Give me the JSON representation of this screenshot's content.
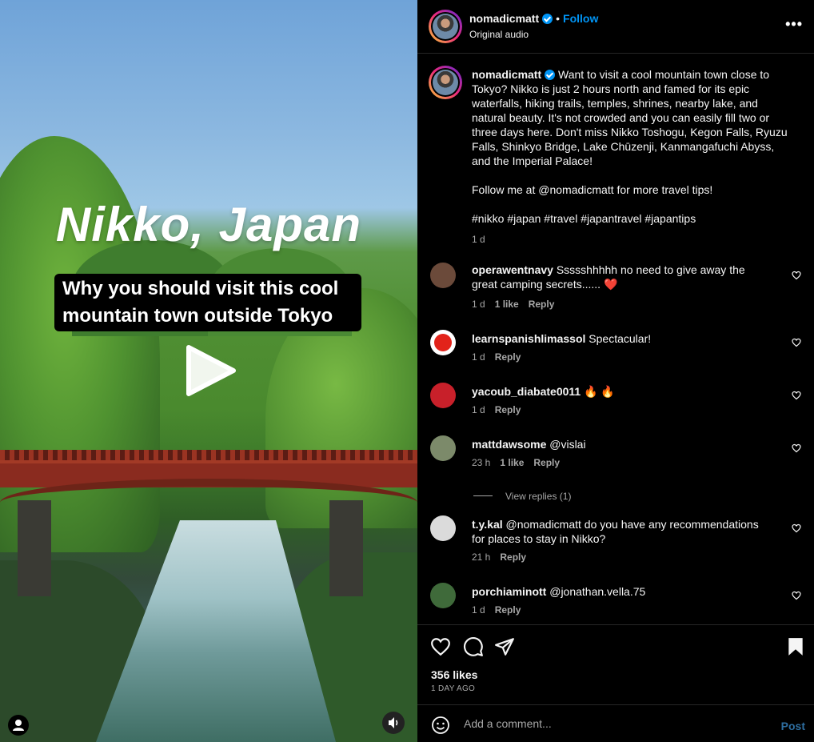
{
  "video": {
    "title": "Nikko, Japan",
    "subtitle": "Why you should visit this cool mountain town outside Tokyo"
  },
  "header": {
    "username": "nomadicmatt",
    "follow_label": "Follow",
    "audio_label": "Original audio",
    "more_label": "•••"
  },
  "caption": {
    "username": "nomadicmatt",
    "text": "Want to visit a cool mountain town close to Tokyo? Nikko is just 2 hours north and famed for its epic waterfalls, hiking trails, temples, shrines, nearby lake, and natural beauty. It's not crowded and you can easily fill two or three days here. Don't miss Nikko Toshogu, Kegon Falls, Ryuzu Falls, Shinkyo Bridge, Lake Chūzenji, Kanmangafuchi Abyss, and the Imperial Palace!",
    "follow_text": "Follow me at @nomadicmatt for more travel tips!",
    "hashtags": "#nikko #japan #travel #japantravel #japantips",
    "time": "1 d"
  },
  "comments": [
    {
      "username": "operawentnavy",
      "text": "Ssssshhhhh no need to give away the great camping secrets...... ❤️",
      "time": "1 d",
      "likes": "1 like",
      "reply": "Reply",
      "avatar_color": "#6b4a3a"
    },
    {
      "username": "learnspanishlimassol",
      "text": "Spectacular!",
      "time": "1 d",
      "likes": "",
      "reply": "Reply",
      "avatar_color": "#e2231a"
    },
    {
      "username": "yacoub_diabate0011",
      "text": "🔥 🔥",
      "time": "1 d",
      "likes": "",
      "reply": "Reply",
      "avatar_color": "#c8202a"
    },
    {
      "username": "mattdawsome",
      "text": "@vislai",
      "time": "23 h",
      "likes": "1 like",
      "reply": "Reply",
      "avatar_color": "#7c8a6a"
    },
    {
      "username": "t.y.kal",
      "text": "@nomadicmatt do you have any recommendations for places to stay in Nikko?",
      "time": "21 h",
      "likes": "",
      "reply": "Reply",
      "avatar_color": "#dbdbdb"
    },
    {
      "username": "porchiaminott",
      "text": "@jonathan.vella.75",
      "time": "1 d",
      "likes": "",
      "reply": "Reply",
      "avatar_color": "#3f6a3a"
    }
  ],
  "view_replies": "View replies (1)",
  "stats": {
    "likes": "356 likes",
    "ago": "1 DAY AGO"
  },
  "add_comment": {
    "placeholder": "Add a comment...",
    "post_label": "Post"
  }
}
